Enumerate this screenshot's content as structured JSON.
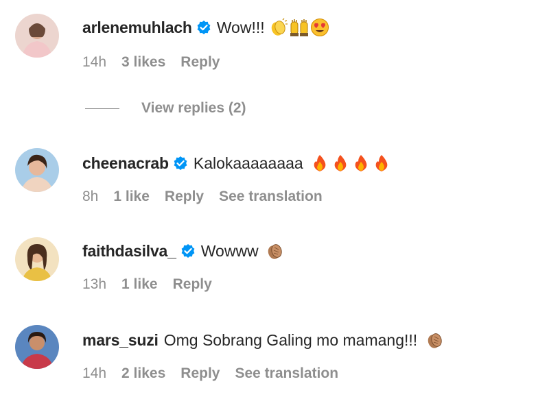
{
  "comments": [
    {
      "username": "arlenemuhlach",
      "verified": true,
      "text": "Wow!!!",
      "emojis": [
        "clapping-hands-emoji",
        "raising-hands-emoji",
        "heart-eyes-emoji"
      ],
      "time": "14h",
      "likes": "3 likes",
      "reply": "Reply",
      "avatar_bg": "#e8c8c4"
    },
    {
      "username": "cheenacrab",
      "verified": true,
      "text": "Kalokaaaaaaaa",
      "emojis": [
        "fire-emoji",
        "fire-emoji",
        "fire-emoji",
        "fire-emoji"
      ],
      "time": "8h",
      "likes": "1 like",
      "reply": "Reply",
      "translation": "See translation",
      "avatar_bg": "#9ec3e0"
    },
    {
      "username": "faithdasilva_",
      "verified": true,
      "text": "Wowww",
      "emojis": [
        "clapping-hands-medium-skin-emoji"
      ],
      "time": "13h",
      "likes": "1 like",
      "reply": "Reply",
      "avatar_bg": "#e9c56a"
    },
    {
      "username": "mars_suzi",
      "verified": false,
      "text": "Omg Sobrang Galing mo mamang!!!",
      "emojis": [
        "clapping-hands-medium-skin-emoji"
      ],
      "time": "14h",
      "likes": "2 likes",
      "reply": "Reply",
      "translation": "See translation",
      "avatar_bg": "#3f6fa8"
    }
  ],
  "view_replies": "View replies (2)",
  "colors": {
    "primary_text": "#262626",
    "secondary_text": "#8e8e8e",
    "verified_blue": "#0095f6"
  }
}
